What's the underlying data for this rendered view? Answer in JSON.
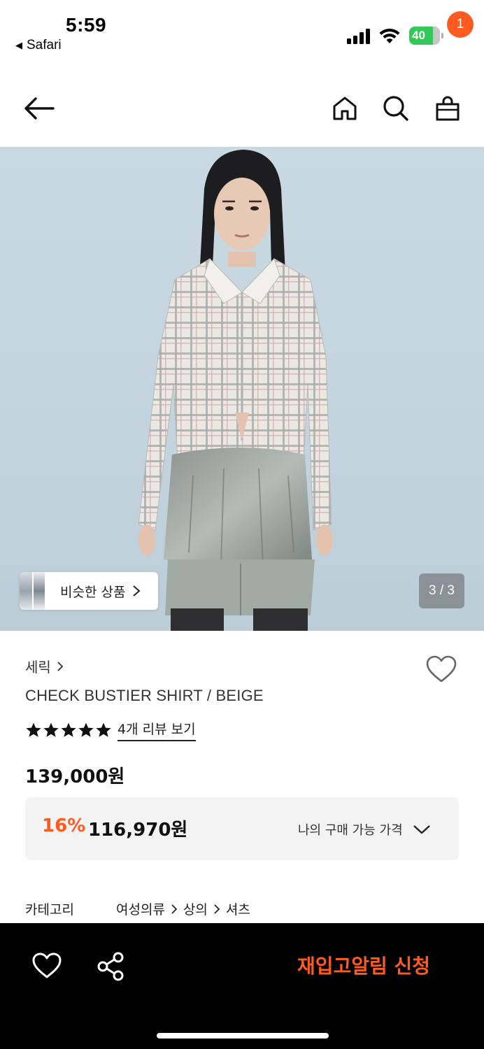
{
  "status_bar": {
    "time": "5:59",
    "back_app": "Safari",
    "battery": "40"
  },
  "header": {
    "back_icon": "arrow-left-icon",
    "home_icon": "home-icon",
    "search_icon": "search-icon",
    "cart_icon": "shopping-bag-icon",
    "cart_count": "1"
  },
  "gallery": {
    "similar_label": "비슷한 상품",
    "counter": "3 / 3",
    "current_index": 3,
    "total": 3
  },
  "product": {
    "brand": "세릭",
    "name": "CHECK BUSTIER SHIRT / BEIGE",
    "rating": 5,
    "review_link": "4개 리뷰 보기",
    "original_price": "139,000원",
    "discount_rate": "16%",
    "sale_price": "116,970원",
    "my_price_label": "나의 구매 가능 가격",
    "category_label": "카테고리",
    "categories": [
      "여성의류",
      "상의",
      "셔츠"
    ]
  },
  "bottom_bar": {
    "heart_icon": "heart-icon",
    "share_icon": "share-icon",
    "restock_label": "재입고알림 신청"
  },
  "colors": {
    "accent": "#ff5a1f",
    "bottom_bar_bg": "#000000",
    "price_box_bg": "#f3f3f3"
  }
}
